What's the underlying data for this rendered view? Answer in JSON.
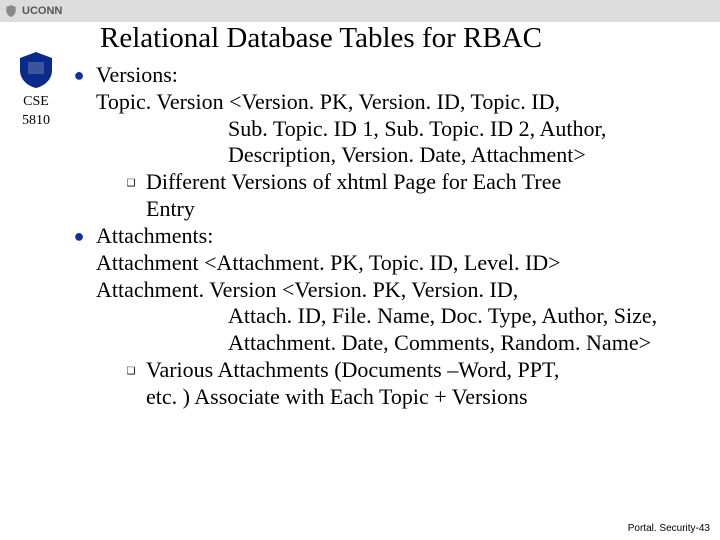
{
  "topbar": {
    "brand": "UCONN"
  },
  "sidebar": {
    "course1": "CSE",
    "course2": "5810"
  },
  "title": "Relational Database Tables for RBAC",
  "b1": {
    "heading": "Versions:",
    "line1": "Topic. Version <Version. PK, Version. ID, Topic. ID,",
    "line2": "Sub. Topic. ID 1, Sub. Topic. ID 2, Author,",
    "line3": "Description, Version. Date, Attachment>",
    "sub1a": "Different Versions of xhtml Page for Each Tree",
    "sub1b": "Entry"
  },
  "b2": {
    "heading": "Attachments:",
    "line1": "Attachment <Attachment. PK, Topic. ID, Level. ID>",
    "line2": "Attachment. Version <Version. PK, Version. ID,",
    "line3": "Attach. ID, File. Name, Doc. Type, Author, Size,",
    "line4": "Attachment. Date, Comments, Random. Name>",
    "sub1a": "Various Attachments (Documents –Word, PPT,",
    "sub1b": "etc. ) Associate with Each Topic + Versions"
  },
  "footer": "Portal. Security-43"
}
